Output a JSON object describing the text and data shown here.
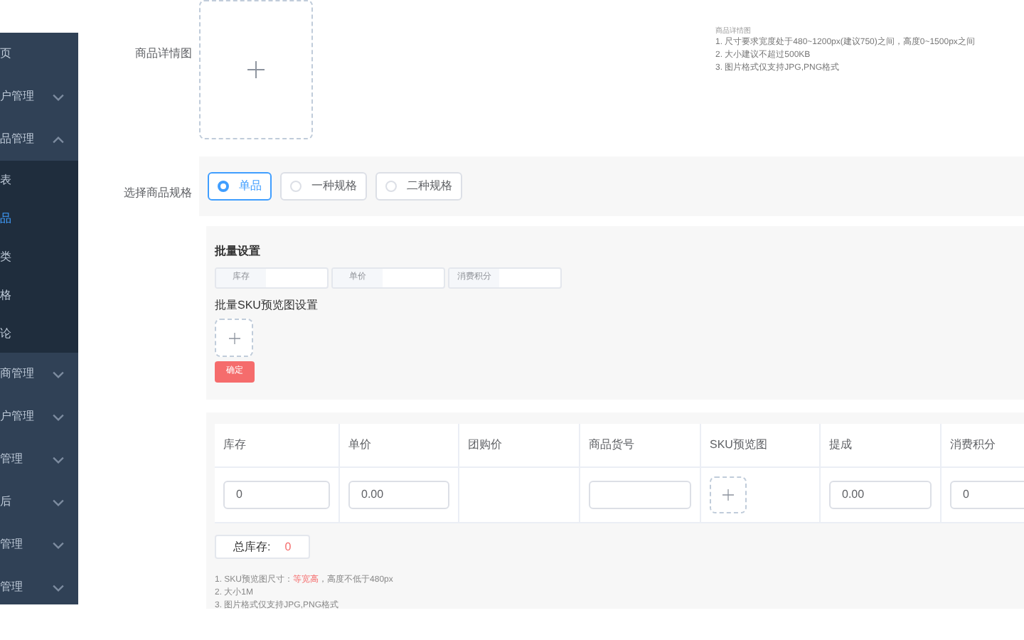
{
  "sidebar": {
    "items": [
      {
        "label": "页"
      },
      {
        "label": "户管理",
        "expanded": false
      },
      {
        "label": "品管理",
        "expanded": true,
        "children": [
          {
            "label": "表",
            "selected": false
          },
          {
            "label": "品",
            "selected": true
          },
          {
            "label": "类",
            "selected": false
          },
          {
            "label": "格",
            "selected": false
          },
          {
            "label": "论",
            "selected": false
          }
        ]
      },
      {
        "label": "商管理",
        "expanded": false
      },
      {
        "label": "户管理",
        "expanded": false
      },
      {
        "label": "管理",
        "expanded": false
      },
      {
        "label": "后",
        "expanded": false
      },
      {
        "label": "管理",
        "expanded": false
      },
      {
        "label": "管理",
        "expanded": false
      }
    ]
  },
  "detail_image": {
    "label": "商品详情图",
    "hint_title": "商品详情图",
    "hints": [
      "1. 尺寸要求宽度处于480~1200px(建议750)之间，高度0~1500px之间",
      "2. 大小建议不超过500KB",
      "3. 图片格式仅支持JPG,PNG格式"
    ]
  },
  "spec": {
    "label": "选择商品规格",
    "options": [
      {
        "label": "单品",
        "selected": true
      },
      {
        "label": "一种规格",
        "selected": false
      },
      {
        "label": "二种规格",
        "selected": false
      }
    ]
  },
  "batch": {
    "title": "批量设置",
    "fields": [
      {
        "label": "库存"
      },
      {
        "label": "单价"
      },
      {
        "label": "消费积分"
      }
    ],
    "sku_title": "批量SKU预览图设置",
    "confirm": "确定"
  },
  "table": {
    "columns": [
      "库存",
      "单价",
      "团购价",
      "商品货号",
      "SKU预览图",
      "提成",
      "消费积分"
    ],
    "row": [
      {
        "kind": "input",
        "value": "0"
      },
      {
        "kind": "input",
        "value": "0.00"
      },
      {
        "kind": "empty"
      },
      {
        "kind": "input"
      },
      {
        "kind": "upload"
      },
      {
        "kind": "input",
        "value": "0.00"
      },
      {
        "kind": "input",
        "value": "0"
      }
    ]
  },
  "total": {
    "label": "总库存:",
    "value": "0"
  },
  "notes": [
    {
      "before": "1. SKU预览图尺寸：",
      "highlight": "等宽高",
      "after": "，高度不低于480px"
    },
    {
      "before": "2. 大小1M"
    },
    {
      "before": "3. 图片格式仅支持JPG,PNG格式"
    }
  ]
}
